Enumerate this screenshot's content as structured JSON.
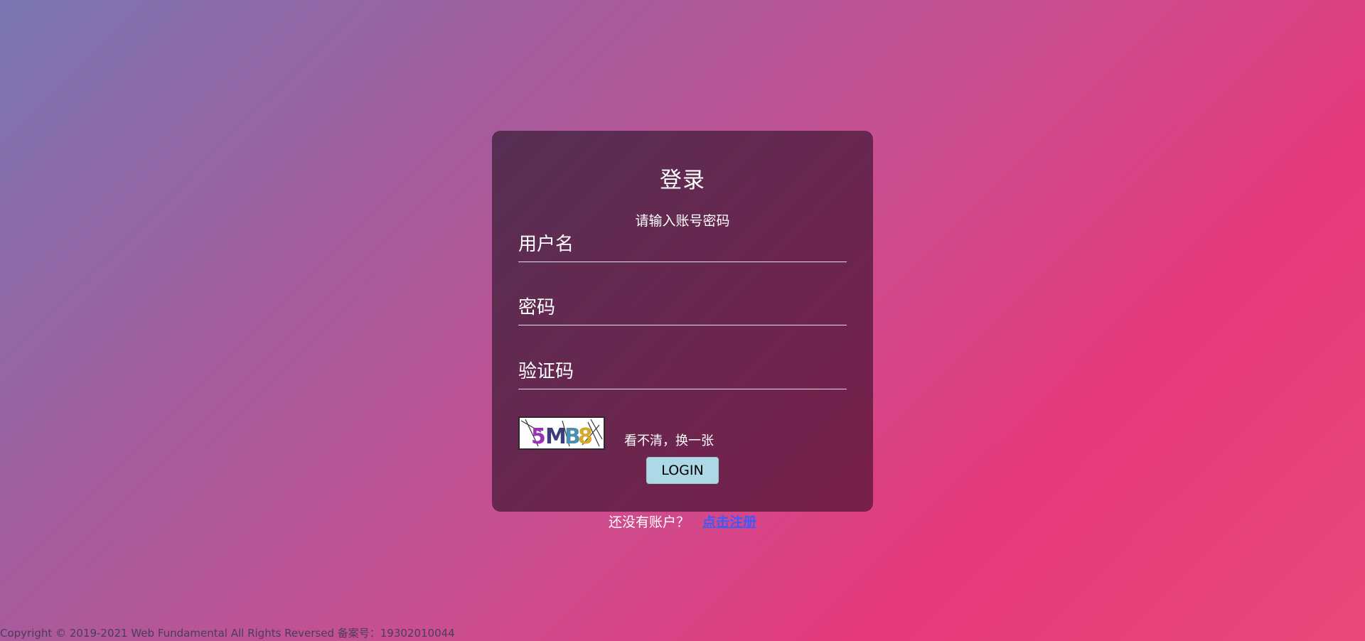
{
  "login": {
    "title": "登录",
    "subtitle": "请输入账号密码",
    "username_placeholder": "用户名",
    "password_placeholder": "密码",
    "captcha_placeholder": "验证码",
    "captcha_text": "5MB8",
    "refresh_label": "看不清，换一张",
    "login_button": "LOGIN"
  },
  "register": {
    "prompt": "还没有账户？",
    "link": "点击注册"
  },
  "footer": {
    "copyright": "Copyright © 2019-2021 Web Fundamental All Rights Reversed 备案号：19302010044"
  },
  "colors": {
    "login_button": "#add8e6",
    "register_link": "#3a5cff"
  }
}
